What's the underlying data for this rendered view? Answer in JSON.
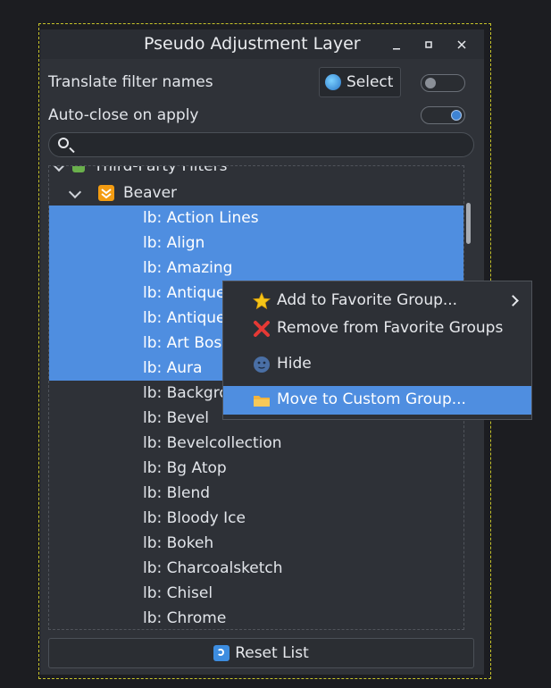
{
  "window": {
    "title": "Pseudo Adjustment Layer",
    "minimize_icon": "minimize-icon",
    "maximize_icon": "maximize-icon",
    "close_icon": "close-icon"
  },
  "options": {
    "translate_label": "Translate filter names",
    "select_button_label": "Select",
    "translate_toggle": false,
    "autoclose_label": "Auto-close on apply",
    "autoclose_toggle": true
  },
  "search": {
    "placeholder": "",
    "value": ""
  },
  "tree": {
    "group": "Third-Party Filters",
    "subgroup": "Beaver",
    "items": [
      {
        "label": "lb: Action Lines",
        "selected": true
      },
      {
        "label": "lb: Align",
        "selected": true
      },
      {
        "label": "lb: Amazing",
        "selected": true
      },
      {
        "label": "lb: Antique",
        "selected": true
      },
      {
        "label": "lb: Antique",
        "selected": true
      },
      {
        "label": "lb: Art Boss",
        "selected": true
      },
      {
        "label": "lb: Aura",
        "selected": true
      },
      {
        "label": "lb: Backgro",
        "selected": false
      },
      {
        "label": "lb: Bevel",
        "selected": false
      },
      {
        "label": "lb: Bevelcollection",
        "selected": false
      },
      {
        "label": "lb: Bg Atop",
        "selected": false
      },
      {
        "label": "lb: Blend",
        "selected": false
      },
      {
        "label": "lb: Bloody Ice",
        "selected": false
      },
      {
        "label": "lb: Bokeh",
        "selected": false
      },
      {
        "label": "lb: Charcoalsketch",
        "selected": false
      },
      {
        "label": "lb: Chisel",
        "selected": false
      },
      {
        "label": "lb: Chrome",
        "selected": false
      }
    ]
  },
  "context_menu": {
    "items": [
      {
        "label": "Add to Favorite Group...",
        "icon": "star-icon",
        "submenu": true
      },
      {
        "label": "Remove from Favorite Groups",
        "icon": "red-x-icon"
      },
      {
        "label": "Hide",
        "icon": "moon-face-icon"
      },
      {
        "label": "Move to Custom Group...",
        "icon": "folder-icon",
        "highlighted": true
      }
    ]
  },
  "footer": {
    "reset_label": "Reset List"
  },
  "colors": {
    "accent": "#4f8ee0",
    "window_bg": "#2f3238",
    "desktop_bg": "#1c1d21"
  }
}
